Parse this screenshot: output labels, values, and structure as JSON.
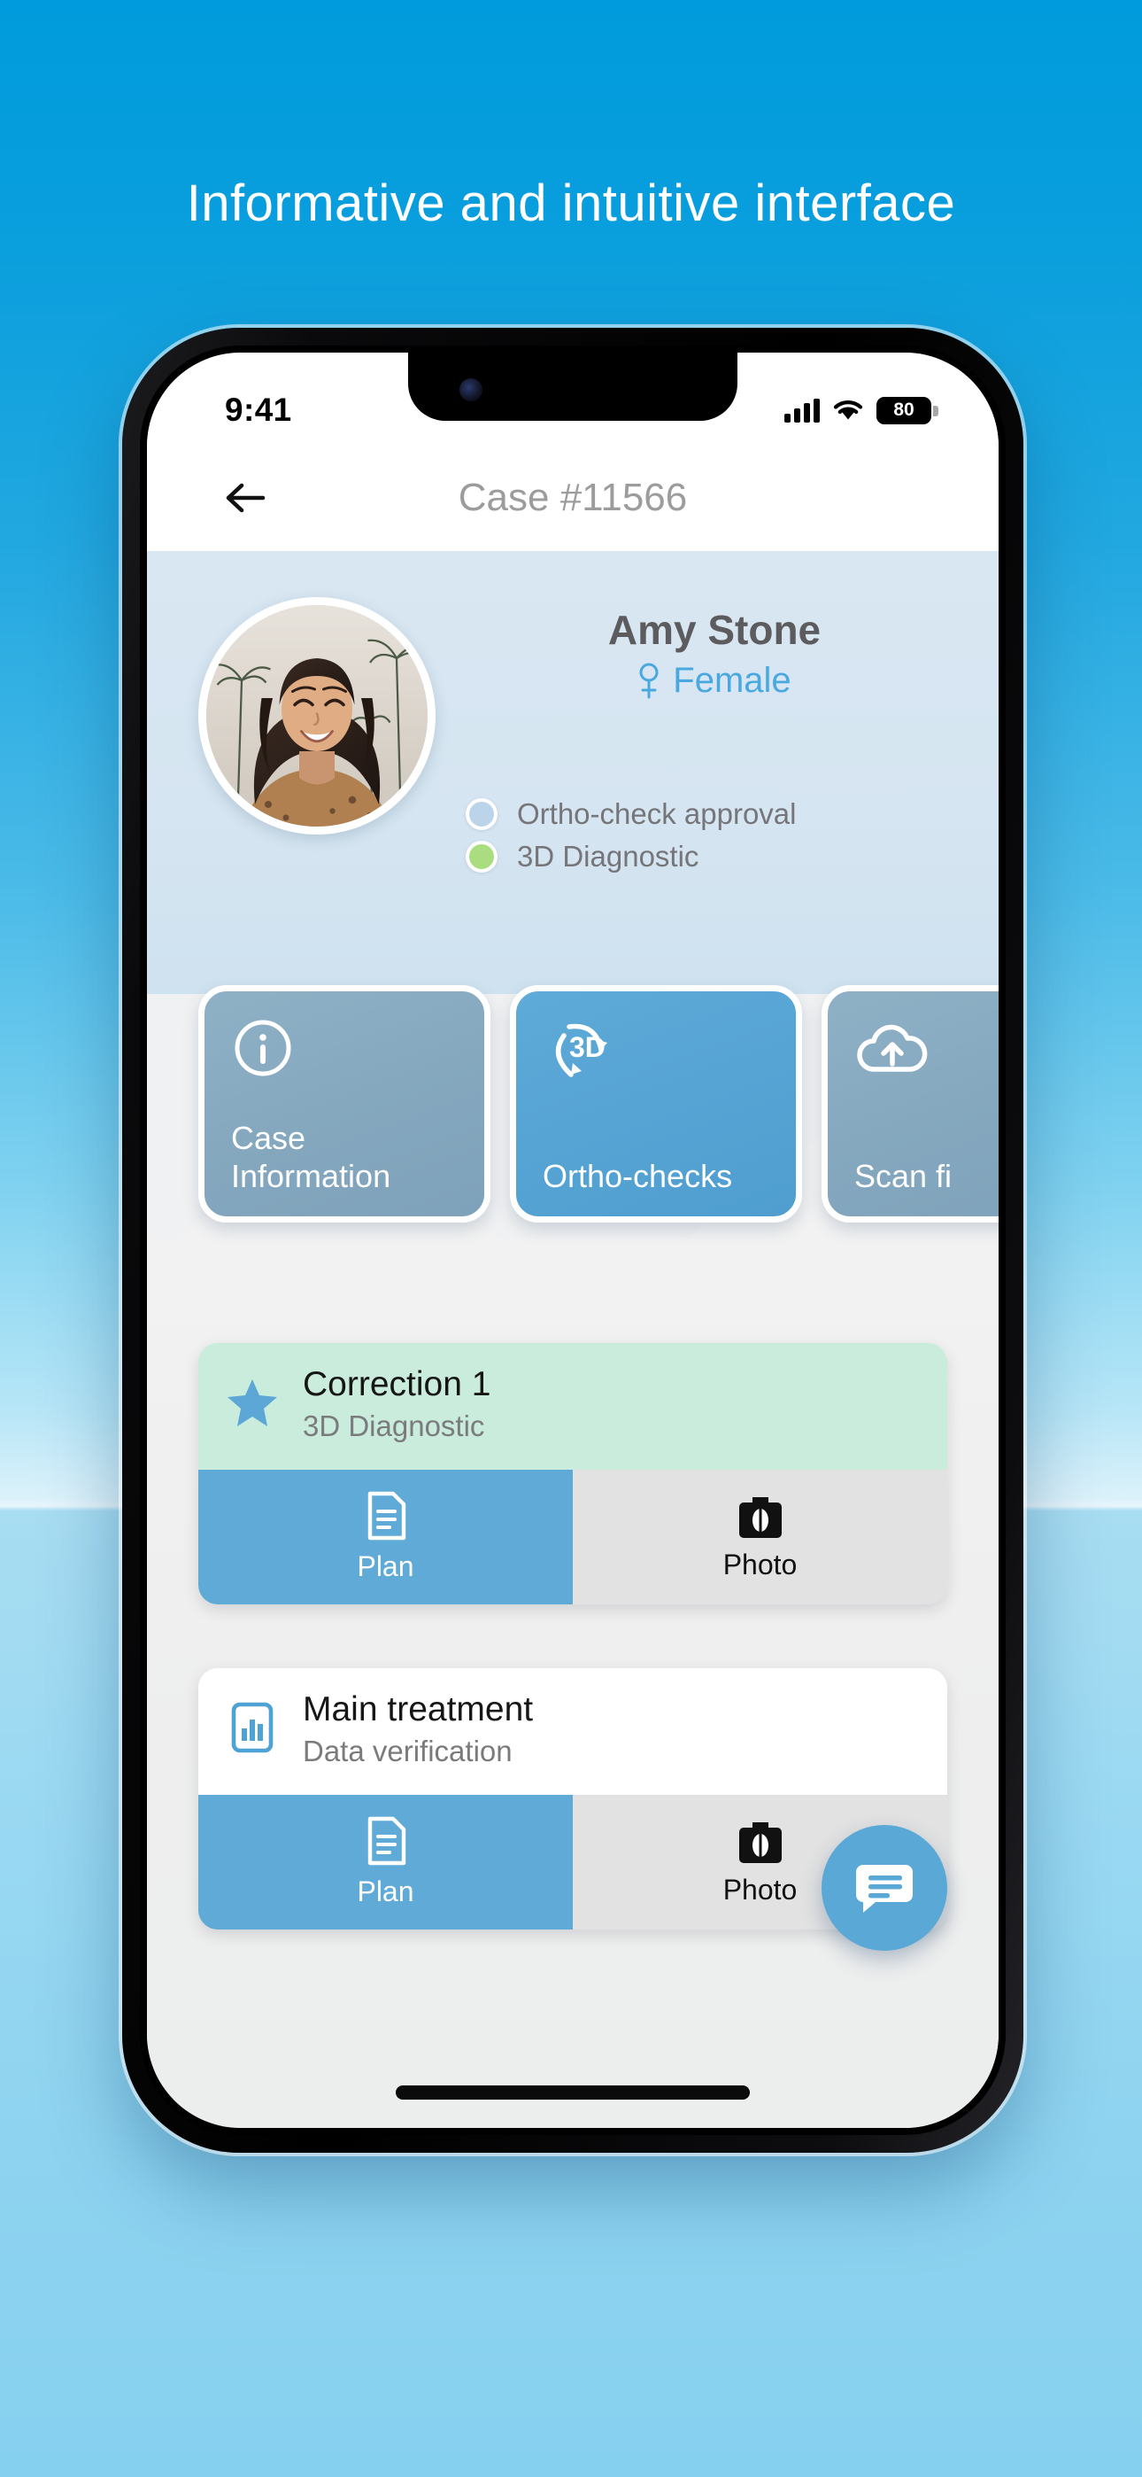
{
  "promo": {
    "headline": "Informative and intuitive interface"
  },
  "status_bar": {
    "time": "9:41",
    "cellular_icon": "signal-bars-icon",
    "wifi_icon": "wifi-icon",
    "battery_level": "80"
  },
  "nav": {
    "back_icon": "back-arrow-icon",
    "title": "Case #11566"
  },
  "patient": {
    "avatar_alt": "patient-avatar",
    "name": "Amy Stone",
    "gender_icon": "female-symbol-icon",
    "gender": "Female",
    "statuses": [
      {
        "label": "Ortho-check approval",
        "color": "#bcd4ea",
        "state": "pending"
      },
      {
        "label": "3D Diagnostic",
        "color": "#a9dd7f",
        "state": "done"
      }
    ]
  },
  "action_cards": [
    {
      "label": "Case Information",
      "icon": "info-circle-icon",
      "style": "muted"
    },
    {
      "label": "Ortho-checks",
      "icon": "3d-rotate-icon",
      "style": "bright"
    },
    {
      "label": "Scan fi",
      "icon": "cloud-upload-icon",
      "style": "muted"
    }
  ],
  "treatments": [
    {
      "title": "Correction 1",
      "subtitle": "3D Diagnostic",
      "icon": "star-icon",
      "head_style": "green",
      "buttons": [
        {
          "label": "Plan",
          "icon": "document-icon",
          "style": "plan"
        },
        {
          "label": "Photo",
          "icon": "camera-icon",
          "style": "photo"
        }
      ]
    },
    {
      "title": "Main treatment",
      "subtitle": "Data verification",
      "icon": "bar-chart-icon",
      "head_style": "white",
      "buttons": [
        {
          "label": "Plan",
          "icon": "document-icon",
          "style": "plan"
        },
        {
          "label": "Photo",
          "icon": "camera-icon",
          "style": "photo"
        }
      ]
    }
  ],
  "fab": {
    "icon": "chat-bubble-icon",
    "label": "Chat"
  },
  "colors": {
    "page_top": "#009bdc",
    "page_bottom": "#86d0ef",
    "accent_blue": "#5faad6",
    "header_bg": "#d7e5f1",
    "green_card": "#c9ecdc",
    "status_green": "#a9dd7f",
    "status_pending": "#bcd4ea",
    "gender_blue": "#4aa8e0"
  }
}
